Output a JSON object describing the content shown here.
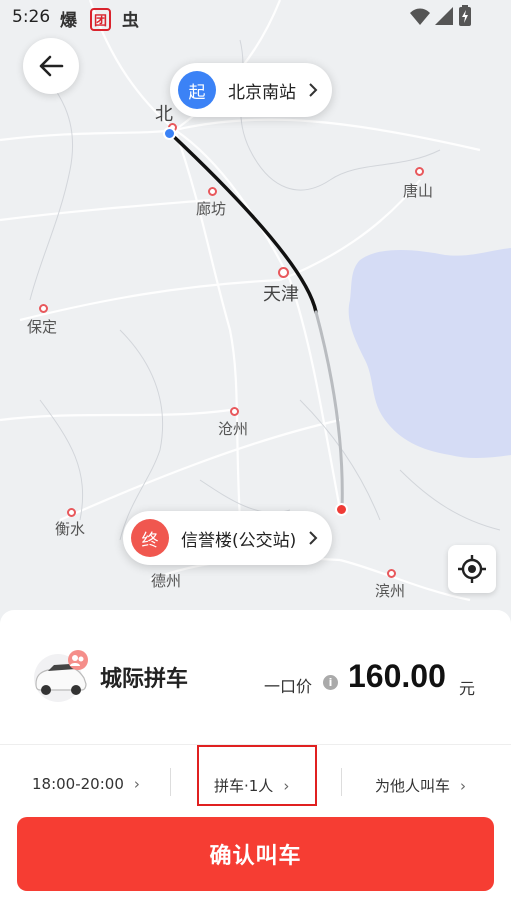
{
  "status_bar": {
    "time": "5:26",
    "app_icons": [
      "爆",
      "团",
      "虫"
    ]
  },
  "map": {
    "cities": [
      {
        "name": "北",
        "key": "beijing"
      },
      {
        "name": "唐山",
        "key": "tangshan"
      },
      {
        "name": "廊坊",
        "key": "langfang"
      },
      {
        "name": "天津",
        "key": "tianjin"
      },
      {
        "name": "保定",
        "key": "baoding"
      },
      {
        "name": "沧州",
        "key": "cangzhou"
      },
      {
        "name": "衡水",
        "key": "hengshui"
      },
      {
        "name": "德州",
        "key": "dezhou"
      },
      {
        "name": "滨州",
        "key": "binzhou"
      }
    ]
  },
  "start": {
    "badge": "起",
    "label": "北京南站",
    "color": "#3b82f6"
  },
  "end": {
    "badge": "终",
    "label": "信誉楼(公交站)",
    "color": "#f0574f"
  },
  "panel": {
    "service_name": "城际拼车",
    "price_label": "一口价",
    "price": "160.00",
    "unit": "元"
  },
  "options": [
    {
      "label": "18:00-20:00"
    },
    {
      "label": "拼车·1人"
    },
    {
      "label": "为他人叫车"
    }
  ],
  "confirm_label": "确认叫车",
  "colors": {
    "accent": "#f63d33",
    "start": "#3b82f6",
    "end": "#f0574f"
  }
}
